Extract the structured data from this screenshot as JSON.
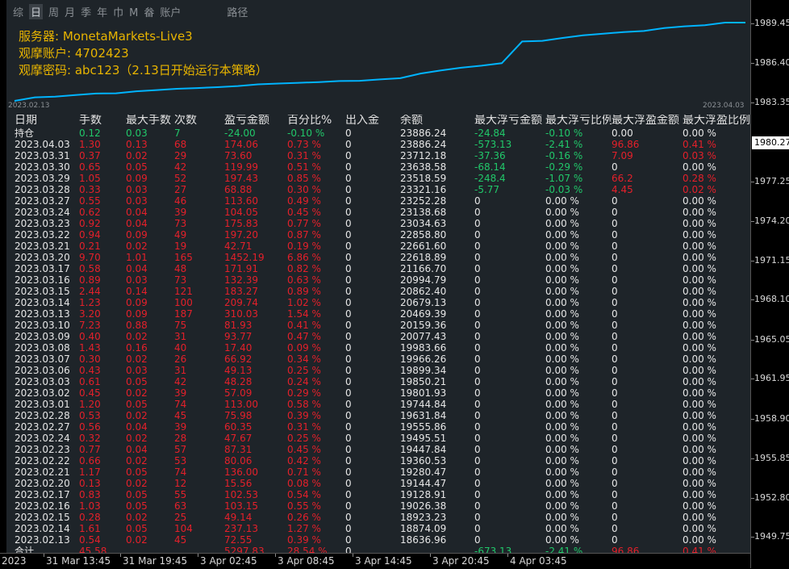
{
  "toolbar": {
    "items": [
      "综",
      "日",
      "周",
      "月",
      "季",
      "年",
      "巾",
      "M",
      "畚",
      "账户"
    ],
    "active_index": 1,
    "extra": "路径"
  },
  "info": {
    "server": "服务器: MonetaMarkets-Live3",
    "account": "观摩账户: 4702423",
    "password": "观摩密码: abc123（2.13日开始运行本策略）"
  },
  "equity_chart": {
    "start_label": "2023.02.13",
    "end_label": "2023.04.03",
    "values": [
      18636.96,
      18874.09,
      18923.23,
      19026.38,
      19128.91,
      19144.47,
      19280.47,
      19360.53,
      19447.84,
      19495.51,
      19555.86,
      19631.84,
      19744.84,
      19801.93,
      19850.21,
      19899.34,
      19966.26,
      19983.66,
      20077.43,
      20159.36,
      20469.39,
      20679.13,
      20862.4,
      20994.79,
      21166.7,
      22618.89,
      22661.6,
      22858.8,
      23034.63,
      23138.68,
      23252.28,
      23321.16,
      23518.59,
      23638.58,
      23712.18,
      23886.24,
      23886.24
    ],
    "line_color": "#00b4ff"
  },
  "table": {
    "headers": [
      "日期",
      "手数",
      "最大手数",
      "次数",
      "盈亏金额",
      "百分比%",
      "出入金",
      "余额",
      "最大浮亏金额",
      "最大浮亏比例",
      "最大浮盈金额",
      "最大浮盈比例"
    ],
    "holding": {
      "date": "持仓",
      "lots": "0.12",
      "max_lots": "0.03",
      "count": "7",
      "pnl": "-24.00",
      "pct": "-0.10 %",
      "io": "0",
      "balance": "23886.24",
      "max_float_loss": "-24.84",
      "max_float_loss_pct": "-0.10 %",
      "max_float_profit": "0.00",
      "max_float_profit_pct": "0.00 %"
    },
    "rows": [
      [
        "2023.04.03",
        "1.30",
        "0.13",
        "68",
        "174.06",
        "0.73 %",
        "0",
        "23886.24",
        "-573.13",
        "-2.41 %",
        "96.86",
        "0.41 %"
      ],
      [
        "2023.03.31",
        "0.37",
        "0.02",
        "29",
        "73.60",
        "0.31 %",
        "0",
        "23712.18",
        "-37.36",
        "-0.16 %",
        "7.09",
        "0.03 %"
      ],
      [
        "2023.03.30",
        "0.65",
        "0.05",
        "42",
        "119.99",
        "0.51 %",
        "0",
        "23638.58",
        "-68.14",
        "-0.29 %",
        "0",
        "0.00 %"
      ],
      [
        "2023.03.29",
        "1.05",
        "0.09",
        "52",
        "197.43",
        "0.85 %",
        "0",
        "23518.59",
        "-248.4",
        "-1.07 %",
        "66.2",
        "0.28 %"
      ],
      [
        "2023.03.28",
        "0.33",
        "0.03",
        "27",
        "68.88",
        "0.30 %",
        "0",
        "23321.16",
        "-5.77",
        "-0.03 %",
        "4.45",
        "0.02 %"
      ],
      [
        "2023.03.27",
        "0.55",
        "0.03",
        "46",
        "113.60",
        "0.49 %",
        "0",
        "23252.28",
        "0",
        "0.00 %",
        "0",
        "0.00 %"
      ],
      [
        "2023.03.24",
        "0.62",
        "0.04",
        "39",
        "104.05",
        "0.45 %",
        "0",
        "23138.68",
        "0",
        "0.00 %",
        "0",
        "0.00 %"
      ],
      [
        "2023.03.23",
        "0.92",
        "0.04",
        "73",
        "175.83",
        "0.77 %",
        "0",
        "23034.63",
        "0",
        "0.00 %",
        "0",
        "0.00 %"
      ],
      [
        "2023.03.22",
        "0.94",
        "0.09",
        "49",
        "197.20",
        "0.87 %",
        "0",
        "22858.80",
        "0",
        "0.00 %",
        "0",
        "0.00 %"
      ],
      [
        "2023.03.21",
        "0.21",
        "0.02",
        "19",
        "42.71",
        "0.19 %",
        "0",
        "22661.60",
        "0",
        "0.00 %",
        "0",
        "0.00 %"
      ],
      [
        "2023.03.20",
        "9.70",
        "1.01",
        "165",
        "1452.19",
        "6.86 %",
        "0",
        "22618.89",
        "0",
        "0.00 %",
        "0",
        "0.00 %"
      ],
      [
        "2023.03.17",
        "0.58",
        "0.04",
        "48",
        "171.91",
        "0.82 %",
        "0",
        "21166.70",
        "0",
        "0.00 %",
        "0",
        "0.00 %"
      ],
      [
        "2023.03.16",
        "0.89",
        "0.03",
        "73",
        "132.39",
        "0.63 %",
        "0",
        "20994.79",
        "0",
        "0.00 %",
        "0",
        "0.00 %"
      ],
      [
        "2023.03.15",
        "2.44",
        "0.14",
        "121",
        "183.27",
        "0.89 %",
        "0",
        "20862.40",
        "0",
        "0.00 %",
        "0",
        "0.00 %"
      ],
      [
        "2023.03.14",
        "1.23",
        "0.09",
        "100",
        "209.74",
        "1.02 %",
        "0",
        "20679.13",
        "0",
        "0.00 %",
        "0",
        "0.00 %"
      ],
      [
        "2023.03.13",
        "3.20",
        "0.09",
        "187",
        "310.03",
        "1.54 %",
        "0",
        "20469.39",
        "0",
        "0.00 %",
        "0",
        "0.00 %"
      ],
      [
        "2023.03.10",
        "7.23",
        "0.88",
        "75",
        "81.93",
        "0.41 %",
        "0",
        "20159.36",
        "0",
        "0.00 %",
        "0",
        "0.00 %"
      ],
      [
        "2023.03.09",
        "0.40",
        "0.02",
        "31",
        "93.77",
        "0.47 %",
        "0",
        "20077.43",
        "0",
        "0.00 %",
        "0",
        "0.00 %"
      ],
      [
        "2023.03.08",
        "1.43",
        "0.16",
        "40",
        "17.40",
        "0.09 %",
        "0",
        "19983.66",
        "0",
        "0.00 %",
        "0",
        "0.00 %"
      ],
      [
        "2023.03.07",
        "0.30",
        "0.02",
        "26",
        "66.92",
        "0.34 %",
        "0",
        "19966.26",
        "0",
        "0.00 %",
        "0",
        "0.00 %"
      ],
      [
        "2023.03.06",
        "0.43",
        "0.03",
        "31",
        "49.13",
        "0.25 %",
        "0",
        "19899.34",
        "0",
        "0.00 %",
        "0",
        "0.00 %"
      ],
      [
        "2023.03.03",
        "0.61",
        "0.05",
        "42",
        "48.28",
        "0.24 %",
        "0",
        "19850.21",
        "0",
        "0.00 %",
        "0",
        "0.00 %"
      ],
      [
        "2023.03.02",
        "0.45",
        "0.02",
        "39",
        "57.09",
        "0.29 %",
        "0",
        "19801.93",
        "0",
        "0.00 %",
        "0",
        "0.00 %"
      ],
      [
        "2023.03.01",
        "1.20",
        "0.05",
        "74",
        "113.00",
        "0.58 %",
        "0",
        "19744.84",
        "0",
        "0.00 %",
        "0",
        "0.00 %"
      ],
      [
        "2023.02.28",
        "0.53",
        "0.02",
        "45",
        "75.98",
        "0.39 %",
        "0",
        "19631.84",
        "0",
        "0.00 %",
        "0",
        "0.00 %"
      ],
      [
        "2023.02.27",
        "0.56",
        "0.04",
        "39",
        "60.35",
        "0.31 %",
        "0",
        "19555.86",
        "0",
        "0.00 %",
        "0",
        "0.00 %"
      ],
      [
        "2023.02.24",
        "0.32",
        "0.02",
        "28",
        "47.67",
        "0.25 %",
        "0",
        "19495.51",
        "0",
        "0.00 %",
        "0",
        "0.00 %"
      ],
      [
        "2023.02.23",
        "0.77",
        "0.04",
        "57",
        "87.31",
        "0.45 %",
        "0",
        "19447.84",
        "0",
        "0.00 %",
        "0",
        "0.00 %"
      ],
      [
        "2023.02.22",
        "0.66",
        "0.02",
        "53",
        "80.06",
        "0.42 %",
        "0",
        "19360.53",
        "0",
        "0.00 %",
        "0",
        "0.00 %"
      ],
      [
        "2023.02.21",
        "1.17",
        "0.05",
        "74",
        "136.00",
        "0.71 %",
        "0",
        "19280.47",
        "0",
        "0.00 %",
        "0",
        "0.00 %"
      ],
      [
        "2023.02.20",
        "0.13",
        "0.02",
        "12",
        "15.56",
        "0.08 %",
        "0",
        "19144.47",
        "0",
        "0.00 %",
        "0",
        "0.00 %"
      ],
      [
        "2023.02.17",
        "0.83",
        "0.05",
        "55",
        "102.53",
        "0.54 %",
        "0",
        "19128.91",
        "0",
        "0.00 %",
        "0",
        "0.00 %"
      ],
      [
        "2023.02.16",
        "1.03",
        "0.05",
        "63",
        "103.15",
        "0.55 %",
        "0",
        "19026.38",
        "0",
        "0.00 %",
        "0",
        "0.00 %"
      ],
      [
        "2023.02.15",
        "0.28",
        "0.02",
        "25",
        "49.14",
        "0.26 %",
        "0",
        "18923.23",
        "0",
        "0.00 %",
        "0",
        "0.00 %"
      ],
      [
        "2023.02.14",
        "1.61",
        "0.05",
        "104",
        "237.13",
        "1.27 %",
        "0",
        "18874.09",
        "0",
        "0.00 %",
        "0",
        "0.00 %"
      ],
      [
        "2023.02.13",
        "0.54",
        "0.02",
        "45",
        "72.55",
        "0.39 %",
        "0",
        "18636.96",
        "0",
        "0.00 %",
        "0",
        "0.00 %"
      ]
    ],
    "total": [
      "合计",
      "45.58",
      "",
      "",
      "5297.83",
      "28.54 %",
      "0",
      "",
      "-673.13",
      "-2.41 %",
      "96.86",
      "0.41 %"
    ]
  },
  "price_axis": {
    "labels": [
      "1989.45",
      "1986.40",
      "1983.35",
      "1980.27",
      "1977.25",
      "1974.20",
      "1971.15",
      "1968.10",
      "1965.05",
      "1961.95",
      "1958.90",
      "1955.85",
      "1952.80",
      "1949.75"
    ],
    "current": "1980.27"
  },
  "time_axis": {
    "labels": [
      "2023",
      "31 Mar 13:45",
      "31 Mar 19:45",
      "3 Apr 02:45",
      "3 Apr 08:45",
      "3 Apr 14:45",
      "3 Apr 20:45",
      "4 Apr 03:45"
    ]
  }
}
